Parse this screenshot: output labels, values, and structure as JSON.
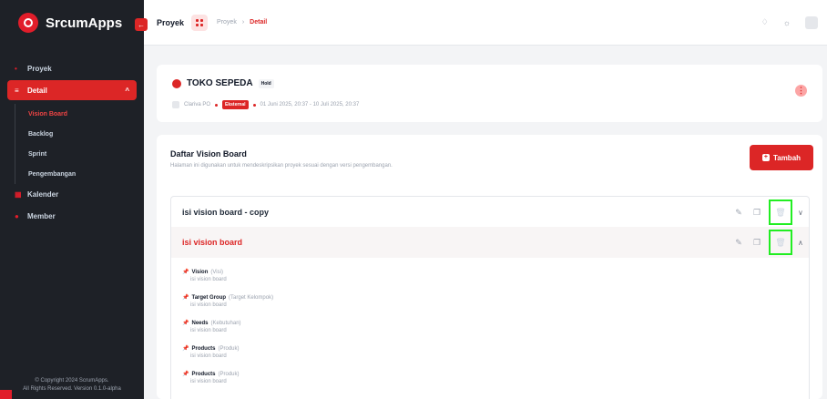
{
  "brand": {
    "name": "SrcumApps"
  },
  "sidebar": {
    "items": [
      {
        "label": "Proyek"
      },
      {
        "label": "Detail"
      },
      {
        "label": "Kalender"
      },
      {
        "label": "Member"
      }
    ],
    "submenu": [
      {
        "label": "Vision Board"
      },
      {
        "label": "Backlog"
      },
      {
        "label": "Sprint"
      },
      {
        "label": "Pengembangan"
      }
    ],
    "copyright_line1": "© Copyright 2024 ScrumApps.",
    "copyright_line2": "All Rights Reserved. Version 0.1.0-alpha"
  },
  "header": {
    "title": "Proyek",
    "breadcrumb": [
      "Proyek",
      "Detail"
    ]
  },
  "project": {
    "name": "TOKO SEPEDA",
    "status": "Hold",
    "owner": "Clariva PO",
    "type": "Eksternal",
    "period": "01 Juni 2025, 20:37 - 10 Juli 2025, 20:37"
  },
  "vision_board": {
    "title": "Daftar Vision Board",
    "description": "Halaman ini digunakan untuk mendeskripsikan proyek sesuai dengan versi pengembangan.",
    "add_label": "Tambah",
    "entries": [
      {
        "title": "isi vision board - copy"
      },
      {
        "title": "isi vision board"
      }
    ],
    "details": [
      {
        "label": "Vision",
        "sub": "(Visi)",
        "value": "isi vision board"
      },
      {
        "label": "Target Group",
        "sub": "(Target Kelompok)",
        "value": "isi vision board"
      },
      {
        "label": "Needs",
        "sub": "(Kebutuhan)",
        "value": "isi vision board"
      },
      {
        "label": "Products",
        "sub": "(Produk)",
        "value": "isi vision board"
      },
      {
        "label": "Products",
        "sub": "(Produk)",
        "value": "isi vision board"
      }
    ]
  },
  "colors": {
    "accent": "#dc2626",
    "sidebar_bg": "#1e2127",
    "highlight_box": "#22ee22"
  },
  "icons": {
    "edit": "pencil-icon",
    "copy": "copy-icon",
    "delete": "trash-icon",
    "expand": "chevron-down-icon",
    "collapse": "chevron-up-icon"
  }
}
